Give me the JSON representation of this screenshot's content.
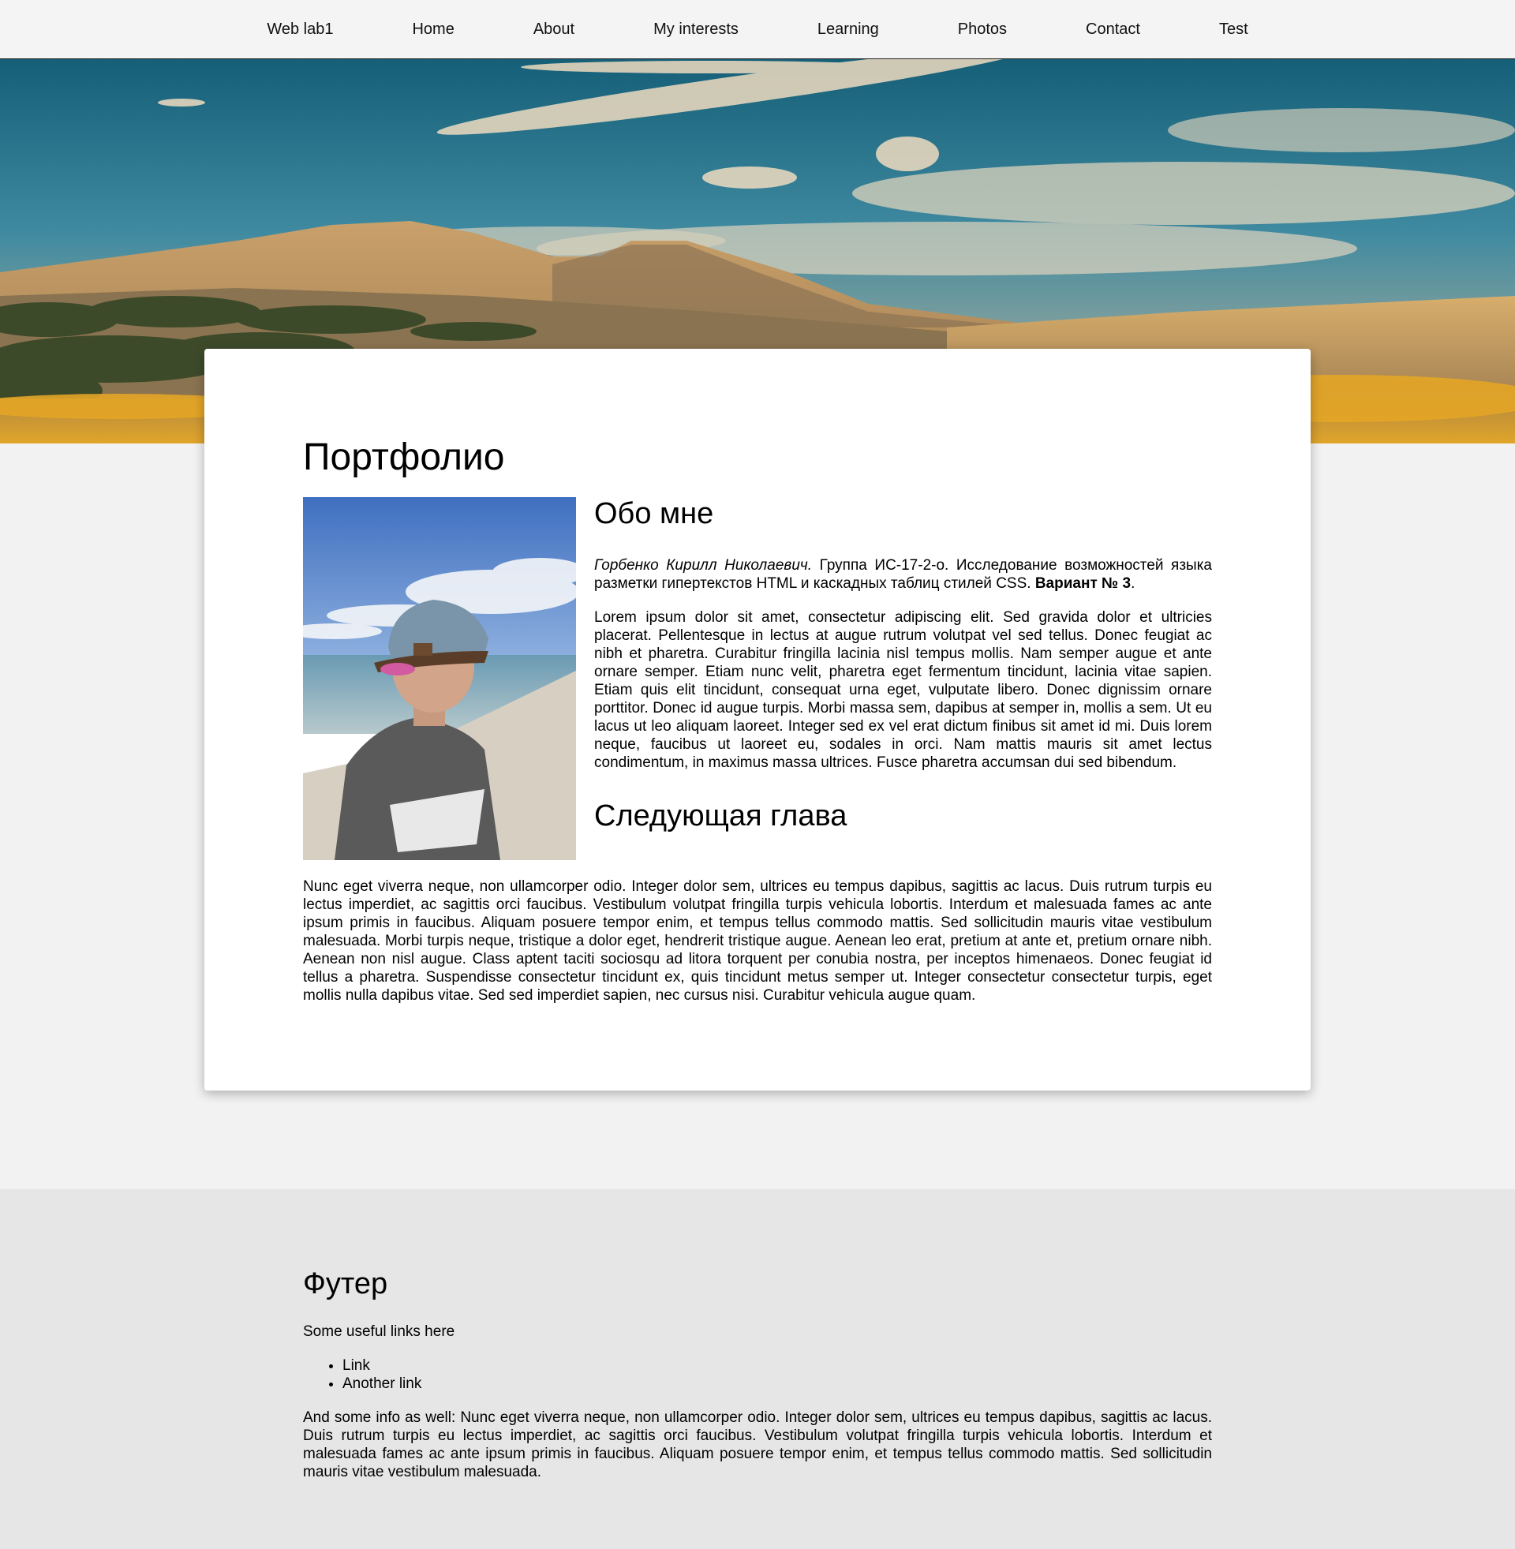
{
  "nav": {
    "items": [
      "Web lab1",
      "Home",
      "About",
      "My interests",
      "Learning",
      "Photos",
      "Contact",
      "Test"
    ]
  },
  "main": {
    "title": "Портфолио",
    "about_heading": "Обо мне",
    "intro_name": "Горбенко Кирилл Николаевич.",
    "intro_text": " Группа ИС-17-2-о. Исследование возможностей языка разметки гипертекстов HTML и каскадных таблиц стилей CSS. ",
    "intro_variant": "Вариант № 3",
    "intro_end": ".",
    "lorem": "Lorem ipsum dolor sit amet, consectetur adipiscing elit. Sed gravida dolor et ultricies placerat. Pellentesque in lectus at augue rutrum volutpat vel sed tellus. Donec feugiat ac nibh et pharetra. Curabitur fringilla lacinia nisl tempus mollis. Nam semper augue et ante ornare semper. Etiam nunc velit, pharetra eget fermentum tincidunt, lacinia vitae sapien. Etiam quis elit tincidunt, consequat urna eget, vulputate libero. Donec dignissim ornare porttitor. Donec id augue turpis. Morbi massa sem, dapibus at semper in, mollis a sem. Ut eu lacus ut leo aliquam laoreet. Integer sed ex vel erat dictum finibus sit amet id mi. Duis lorem neque, faucibus ut laoreet eu, sodales in orci. Nam mattis mauris sit amet lectus condimentum, in maximus massa ultrices. Fusce pharetra accumsan dui sed bibendum.",
    "next_heading": "Следующая глава",
    "next_text": "Nunc eget viverra neque, non ullamcorper odio. Integer dolor sem, ultrices eu tempus dapibus, sagittis ac lacus. Duis rutrum turpis eu lectus imperdiet, ac sagittis orci faucibus. Vestibulum volutpat fringilla turpis vehicula lobortis. Interdum et malesuada fames ac ante ipsum primis in faucibus. Aliquam posuere tempor enim, et tempus tellus commodo mattis. Sed sollicitudin mauris vitae vestibulum malesuada. Morbi turpis neque, tristique a dolor eget, hendrerit tristique augue. Aenean leo erat, pretium at ante et, pretium ornare nibh. Aenean non nisl augue. Class aptent taciti sociosqu ad litora torquent per conubia nostra, per inceptos himenaeos. Donec feugiat id tellus a pharetra. Suspendisse consectetur tincidunt ex, quis tincidunt metus semper ut. Integer consectetur consectetur turpis, eget mollis nulla dapibus vitae. Sed sed imperdiet sapien, nec cursus nisi. Curabitur vehicula augue quam."
  },
  "footer": {
    "title": "Футер",
    "subtitle": "Some useful links here",
    "links": [
      "Link",
      "Another link"
    ],
    "info": "And some info as well: Nunc eget viverra neque, non ullamcorper odio. Integer dolor sem, ultrices eu tempus dapibus, sagittis ac lacus. Duis rutrum turpis eu lectus imperdiet, ac sagittis orci faucibus. Vestibulum volutpat fringilla turpis vehicula lobortis. Interdum et malesuada fames ac ante ipsum primis in faucibus. Aliquam posuere tempor enim, et tempus tellus commodo mattis. Sed sollicitudin mauris vitae vestibulum malesuada."
  },
  "colors": {
    "page_bg": "#f2f2f2",
    "nav_bg": "#f4f4f4",
    "card_bg": "#ffffff",
    "footer_bg": "#e6e6e6"
  }
}
